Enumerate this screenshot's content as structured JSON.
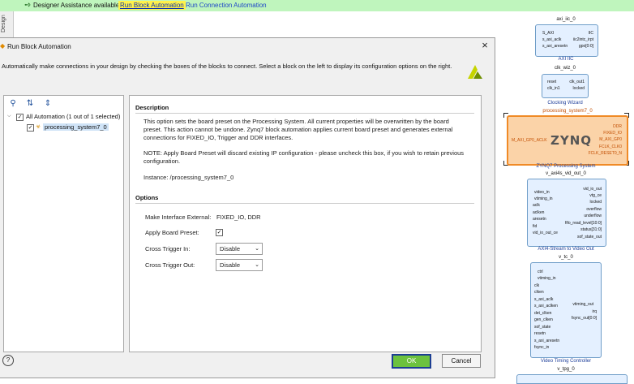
{
  "banner": {
    "text": "Designer Assistance available.",
    "link_block": "Run Block Automation",
    "link_connection": "Run Connection Automation",
    "icon": "wand-icon"
  },
  "side_tab": {
    "label": "Design"
  },
  "dialog": {
    "title": "Run Block Automation",
    "description": "Automatically make connections in your design by checking the boxes of the blocks to connect. Select a block on the left to display its configuration options on the right.",
    "tree": {
      "root_label": "All Automation (1 out of 1 selected)",
      "child_label": "processing_system7_0",
      "root_checked": true,
      "child_checked": true
    },
    "panel": {
      "description_heading": "Description",
      "para1": "This option sets the board preset on the Processing System. All current properties will be overwritten by the board preset. This action cannot be undone. Zynq7 block automation applies current board preset and generates external connections for FIXED_IO, Trigger and DDR interfaces.",
      "para2": "NOTE: Apply Board Preset will discard existing IP configuration - please uncheck this box, if you wish to retain previous configuration.",
      "instance": "Instance: /processing_system7_0",
      "options_heading": "Options",
      "opt_external_label": "Make Interface External:",
      "opt_external_value": "FIXED_IO, DDR",
      "opt_preset_label": "Apply Board Preset:",
      "opt_preset_checked": true,
      "opt_trigger_in_label": "Cross Trigger In:",
      "opt_trigger_in_value": "Disable",
      "opt_trigger_out_label": "Cross Trigger Out:",
      "opt_trigger_out_value": "Disable"
    },
    "ok_label": "OK",
    "cancel_label": "Cancel",
    "help_label": "?"
  },
  "diagram": {
    "axi_iic": {
      "name": "axi_iic_0",
      "caption": "AXI IIC",
      "pins_left": [
        "S_AXI",
        "s_axi_aclk",
        "s_axi_aresetn"
      ],
      "pins_right": [
        "IIC",
        "iic2intc_irpt",
        "gpo[0:0]"
      ]
    },
    "clk_wiz": {
      "name": "clk_wiz_0",
      "caption": "Clocking Wizard",
      "pins_left": [
        "reset",
        "clk_in1"
      ],
      "pins_right": [
        "clk_out1",
        "locked"
      ]
    },
    "ps7": {
      "name": "processing_system7_0",
      "caption": "ZYNQ7 Processing System",
      "logo": "ZYNQ",
      "pin_left": "M_AXI_GP0_ACLK",
      "pins_right": [
        "DDR",
        "FIXED_IO",
        "M_AXI_GP0",
        "FCLK_CLK0",
        "FCLK_RESET0_N"
      ]
    },
    "axi4s": {
      "name": "v_axi4s_vid_out_0",
      "caption": "AXI4-Stream to Video Out",
      "pins_left": [
        "video_in",
        "vtiming_in",
        "aclk",
        "aclken",
        "aresetn",
        "fid",
        "vid_io_out_ce"
      ],
      "pins_right": [
        "vid_io_out",
        "vtg_ce",
        "locked",
        "overflow",
        "underflow",
        "fifo_read_level[10:0]",
        "status[31:0]",
        "sof_state_out"
      ]
    },
    "vtc": {
      "name": "v_tc_0",
      "caption": "Video Timing Controller",
      "pins_left": [
        "ctrl",
        "vtiming_in",
        "clk",
        "clken",
        "s_axi_aclk",
        "s_axi_aclken",
        "det_clken",
        "gen_clken",
        "sof_state",
        "resetn",
        "s_axi_aresetn",
        "fsync_in"
      ],
      "pins_right": [
        "vtiming_out",
        "irq",
        "fsync_out[0:0]"
      ]
    },
    "tpg": {
      "name": "v_tpg_0"
    }
  }
}
